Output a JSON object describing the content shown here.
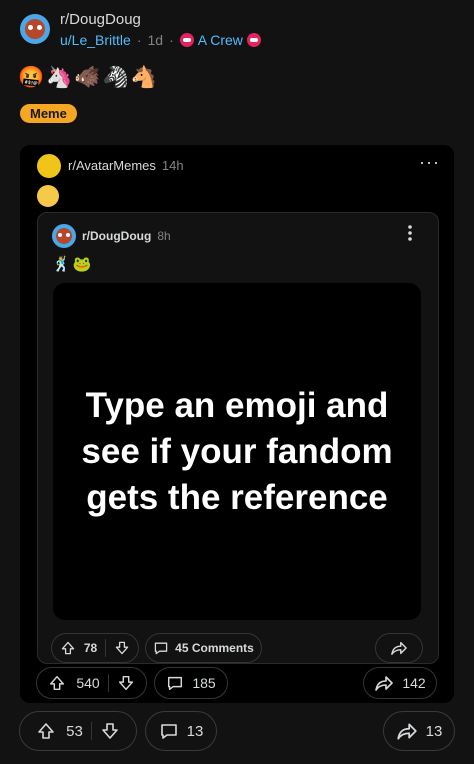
{
  "post": {
    "subreddit": "r/DougDoug",
    "username": "u/Le_Brittle",
    "separator": "·",
    "age": "1d",
    "crew_label": "A Crew",
    "emojis": [
      "🤬",
      "🦄",
      "🐗",
      "🦓",
      "🐴"
    ],
    "flair": "Meme"
  },
  "crosspost": {
    "subreddit": "r/AvatarMemes",
    "age": "14h",
    "more": "···"
  },
  "inner": {
    "subreddit": "r/DougDoug",
    "age": "8h",
    "emojis": [
      "🕺",
      "🐸"
    ],
    "more": "⋮",
    "meme_text": "Type an emoji and see if your fandom gets the reference"
  },
  "inner_actions": {
    "votes": "78",
    "comments": "45 Comments"
  },
  "crosspost_actions": {
    "votes": "540",
    "comments": "185",
    "shares": "142"
  },
  "post_actions": {
    "votes": "53",
    "comments": "13",
    "shares": "13"
  }
}
